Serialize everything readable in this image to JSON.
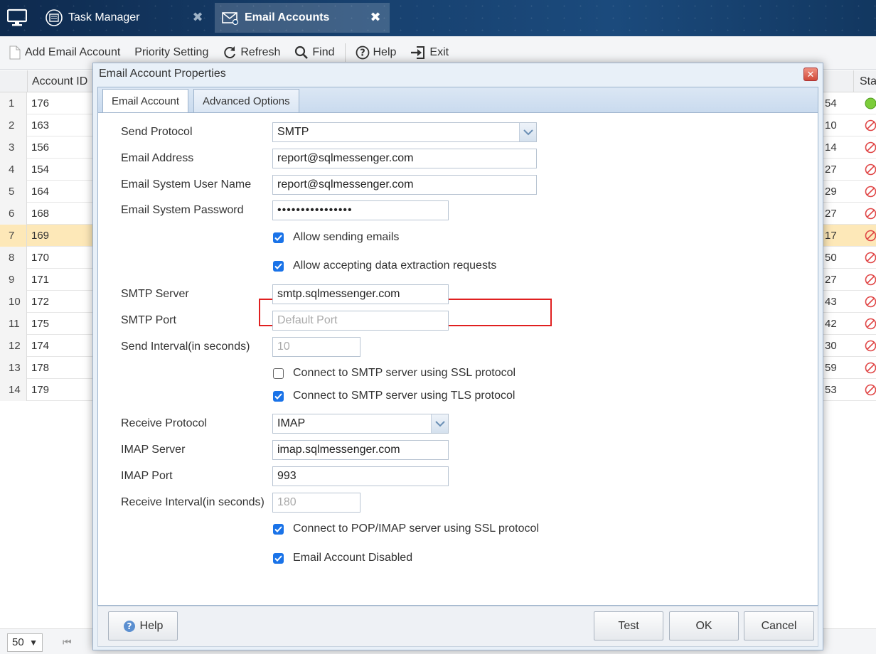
{
  "tabs": [
    {
      "label": "Task Manager",
      "icon": "task-manager-icon",
      "active": false
    },
    {
      "label": "Email Accounts",
      "icon": "email-accounts-icon",
      "active": true
    }
  ],
  "toolbar": {
    "add": "Add Email Account",
    "priority": "Priority Setting",
    "refresh": "Refresh",
    "find": "Find",
    "help": "Help",
    "exit": "Exit"
  },
  "grid": {
    "columns": {
      "id": "Account ID",
      "status": "Stat"
    },
    "rows": [
      {
        "n": "1",
        "id": "176",
        "tail": "54",
        "status": "active"
      },
      {
        "n": "2",
        "id": "163",
        "tail": "10",
        "status": "disabled"
      },
      {
        "n": "3",
        "id": "156",
        "tail": "14",
        "status": "disabled"
      },
      {
        "n": "4",
        "id": "154",
        "tail": "27",
        "status": "disabled"
      },
      {
        "n": "5",
        "id": "164",
        "tail": "29",
        "status": "disabled"
      },
      {
        "n": "6",
        "id": "168",
        "tail": "27",
        "status": "disabled"
      },
      {
        "n": "7",
        "id": "169",
        "tail": "17",
        "status": "disabled",
        "selected": true
      },
      {
        "n": "8",
        "id": "170",
        "tail": "50",
        "status": "disabled"
      },
      {
        "n": "9",
        "id": "171",
        "tail": "27",
        "status": "disabled"
      },
      {
        "n": "10",
        "id": "172",
        "tail": "43",
        "status": "disabled"
      },
      {
        "n": "11",
        "id": "175",
        "tail": "42",
        "status": "disabled"
      },
      {
        "n": "12",
        "id": "174",
        "tail": "30",
        "status": "disabled"
      },
      {
        "n": "13",
        "id": "178",
        "tail": "59",
        "status": "disabled"
      },
      {
        "n": "14",
        "id": "179",
        "tail": "53",
        "status": "disabled"
      }
    ]
  },
  "pager": {
    "page_size": "50"
  },
  "dialog": {
    "title": "Email Account Properties",
    "tabs": [
      "Email Account",
      "Advanced Options"
    ],
    "fields": {
      "send_protocol": {
        "label": "Send Protocol",
        "value": "SMTP"
      },
      "email_address": {
        "label": "Email Address",
        "value": "report@sqlmessenger.com"
      },
      "user_name": {
        "label": "Email System User Name",
        "value": "report@sqlmessenger.com"
      },
      "password": {
        "label": "Email System Password",
        "value": "••••••••••••••••"
      },
      "smtp_server": {
        "label": "SMTP Server",
        "value": "smtp.sqlmessenger.com"
      },
      "smtp_port": {
        "label": "SMTP Port",
        "placeholder": "Default Port"
      },
      "send_interval": {
        "label": "Send Interval(in seconds)",
        "placeholder": "10"
      },
      "receive_protocol": {
        "label": "Receive Protocol",
        "value": "IMAP"
      },
      "imap_server": {
        "label": "IMAP Server",
        "value": "imap.sqlmessenger.com"
      },
      "imap_port": {
        "label": "IMAP Port",
        "value": "993"
      },
      "receive_interval": {
        "label": "Receive Interval(in seconds)",
        "placeholder": "180"
      }
    },
    "checks": {
      "allow_sending": {
        "label": "Allow sending emails",
        "checked": true
      },
      "allow_extraction": {
        "label": "Allow accepting data extraction requests",
        "checked": true
      },
      "smtp_ssl": {
        "label": "Connect to SMTP server using SSL protocol",
        "checked": false
      },
      "smtp_tls": {
        "label": "Connect to SMTP server using TLS protocol",
        "checked": true
      },
      "imap_ssl": {
        "label": "Connect to POP/IMAP server using SSL protocol",
        "checked": true
      },
      "disabled": {
        "label": "Email Account Disabled",
        "checked": true
      }
    },
    "buttons": {
      "help": "Help",
      "test": "Test",
      "ok": "OK",
      "cancel": "Cancel"
    }
  },
  "colors": {
    "accent": "#1a73e8",
    "highlight_box": "#e02020",
    "selected_row": "#fde8b8"
  }
}
